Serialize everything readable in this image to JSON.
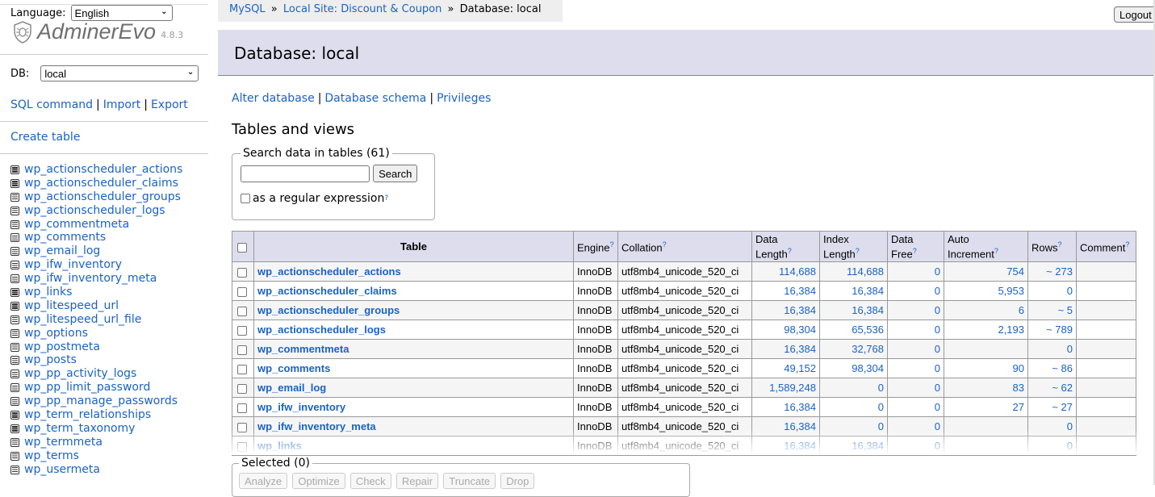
{
  "sidebar": {
    "language_label": "Language:",
    "language_value": "English",
    "brand": "AdminerEvo",
    "version": "4.8.3",
    "db_label": "DB:",
    "db_value": "local",
    "links": [
      "SQL command",
      "Import",
      "Export"
    ],
    "create_table": "Create table",
    "tables": [
      "wp_actionscheduler_actions",
      "wp_actionscheduler_claims",
      "wp_actionscheduler_groups",
      "wp_actionscheduler_logs",
      "wp_commentmeta",
      "wp_comments",
      "wp_email_log",
      "wp_ifw_inventory",
      "wp_ifw_inventory_meta",
      "wp_links",
      "wp_litespeed_url",
      "wp_litespeed_url_file",
      "wp_options",
      "wp_postmeta",
      "wp_posts",
      "wp_pp_activity_logs",
      "wp_pp_limit_password",
      "wp_pp_manage_passwords",
      "wp_term_relationships",
      "wp_term_taxonomy",
      "wp_termmeta",
      "wp_terms",
      "wp_usermeta"
    ]
  },
  "breadcrumb": {
    "items": [
      "MySQL",
      "Local Site: Discount & Coupon"
    ],
    "current": "Database: local",
    "separator": "»"
  },
  "logout_label": "Logout",
  "page_title": "Database: local",
  "db_links": [
    "Alter database",
    "Database schema",
    "Privileges"
  ],
  "section_title": "Tables and views",
  "search": {
    "legend": "Search data in tables (61)",
    "value": "",
    "button": "Search",
    "regex_label": "as a regular expression",
    "help": "?"
  },
  "table": {
    "headers": {
      "table": "Table",
      "engine": "Engine",
      "collation": "Collation",
      "data_length": [
        "Data",
        "Length"
      ],
      "index_length": [
        "Index",
        "Length"
      ],
      "data_free": [
        "Data",
        "Free"
      ],
      "auto_increment": [
        "Auto",
        "Increment"
      ],
      "rows": "Rows",
      "comment": "Comment"
    },
    "rows": [
      {
        "name": "wp_actionscheduler_actions",
        "engine": "InnoDB",
        "collation": "utf8mb4_unicode_520_ci",
        "data_length": "114,688",
        "index_length": "114,688",
        "data_free": "0",
        "auto_increment": "754",
        "rows": "~ 273",
        "comment": ""
      },
      {
        "name": "wp_actionscheduler_claims",
        "engine": "InnoDB",
        "collation": "utf8mb4_unicode_520_ci",
        "data_length": "16,384",
        "index_length": "16,384",
        "data_free": "0",
        "auto_increment": "5,953",
        "rows": "0",
        "comment": ""
      },
      {
        "name": "wp_actionscheduler_groups",
        "engine": "InnoDB",
        "collation": "utf8mb4_unicode_520_ci",
        "data_length": "16,384",
        "index_length": "16,384",
        "data_free": "0",
        "auto_increment": "6",
        "rows": "~ 5",
        "comment": ""
      },
      {
        "name": "wp_actionscheduler_logs",
        "engine": "InnoDB",
        "collation": "utf8mb4_unicode_520_ci",
        "data_length": "98,304",
        "index_length": "65,536",
        "data_free": "0",
        "auto_increment": "2,193",
        "rows": "~ 789",
        "comment": ""
      },
      {
        "name": "wp_commentmeta",
        "engine": "InnoDB",
        "collation": "utf8mb4_unicode_520_ci",
        "data_length": "16,384",
        "index_length": "32,768",
        "data_free": "0",
        "auto_increment": "",
        "rows": "0",
        "comment": ""
      },
      {
        "name": "wp_comments",
        "engine": "InnoDB",
        "collation": "utf8mb4_unicode_520_ci",
        "data_length": "49,152",
        "index_length": "98,304",
        "data_free": "0",
        "auto_increment": "90",
        "rows": "~ 86",
        "comment": ""
      },
      {
        "name": "wp_email_log",
        "engine": "InnoDB",
        "collation": "utf8mb4_unicode_520_ci",
        "data_length": "1,589,248",
        "index_length": "0",
        "data_free": "0",
        "auto_increment": "83",
        "rows": "~ 62",
        "comment": ""
      },
      {
        "name": "wp_ifw_inventory",
        "engine": "InnoDB",
        "collation": "utf8mb4_unicode_520_ci",
        "data_length": "16,384",
        "index_length": "0",
        "data_free": "0",
        "auto_increment": "27",
        "rows": "~ 27",
        "comment": ""
      },
      {
        "name": "wp_ifw_inventory_meta",
        "engine": "InnoDB",
        "collation": "utf8mb4_unicode_520_ci",
        "data_length": "16,384",
        "index_length": "0",
        "data_free": "0",
        "auto_increment": "",
        "rows": "0",
        "comment": ""
      },
      {
        "name": "wp_links",
        "engine": "InnoDB",
        "collation": "utf8mb4_unicode_520_ci",
        "data_length": "16,384",
        "index_length": "16,384",
        "data_free": "0",
        "auto_increment": "",
        "rows": "0",
        "comment": ""
      }
    ]
  },
  "selected": {
    "legend": "Selected (0)",
    "buttons": [
      "Analyze",
      "Optimize",
      "Check",
      "Repair",
      "Truncate",
      "Drop"
    ]
  },
  "colors": {
    "link": "#1a62c8",
    "header_bg": "#dddddd",
    "accent_bg": "#ddddee"
  }
}
